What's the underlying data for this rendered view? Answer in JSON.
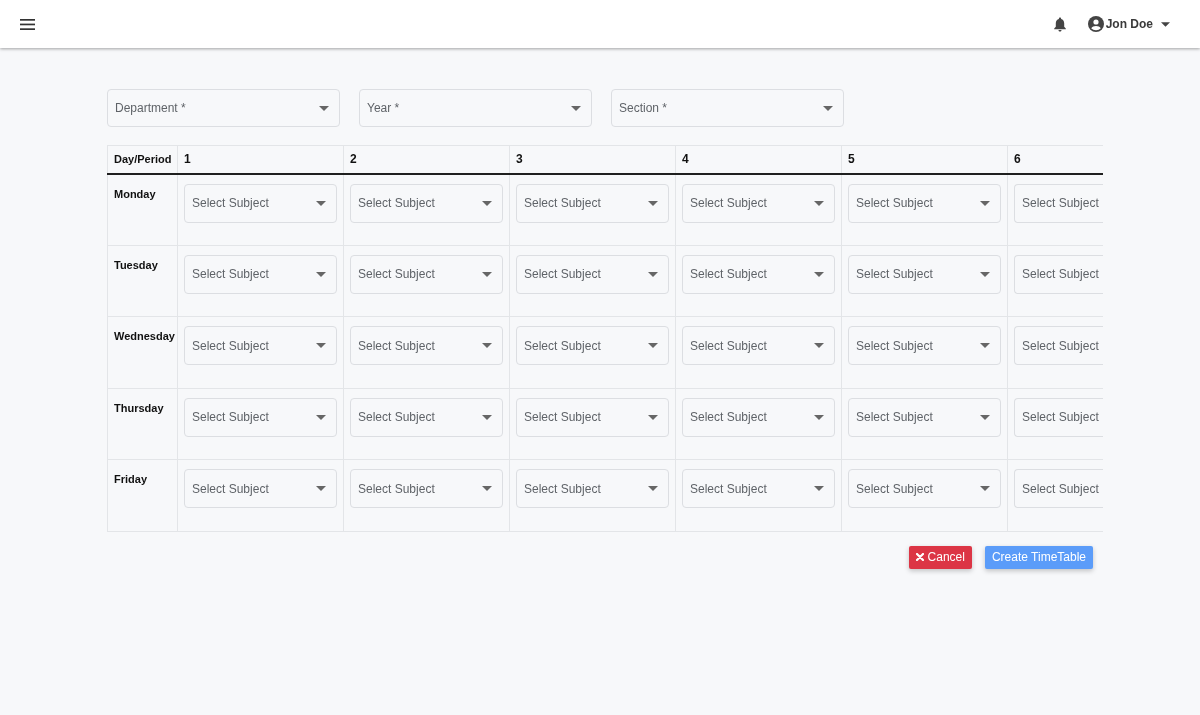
{
  "app_bar": {
    "user_name": "Jon Doe"
  },
  "filters": [
    {
      "placeholder": "Department *"
    },
    {
      "placeholder": "Year *"
    },
    {
      "placeholder": "Section *"
    }
  ],
  "timetable": {
    "corner_heading": "Day/Period",
    "periods": [
      "1",
      "2",
      "3",
      "4",
      "5",
      "6"
    ],
    "rows": [
      {
        "day": "Monday",
        "cells": [
          {
            "placeholder": "Select Subject"
          },
          {
            "placeholder": "Select Subject"
          },
          {
            "placeholder": "Select Subject"
          },
          {
            "placeholder": "Select Subject"
          },
          {
            "placeholder": "Select Subject"
          },
          {
            "placeholder": "Select Subject"
          }
        ]
      },
      {
        "day": "Tuesday",
        "cells": [
          {
            "placeholder": "Select Subject"
          },
          {
            "placeholder": "Select Subject"
          },
          {
            "placeholder": "Select Subject"
          },
          {
            "placeholder": "Select Subject"
          },
          {
            "placeholder": "Select Subject"
          },
          {
            "placeholder": "Select Subject"
          }
        ]
      },
      {
        "day": "Wednesday",
        "cells": [
          {
            "placeholder": "Select Subject"
          },
          {
            "placeholder": "Select Subject"
          },
          {
            "placeholder": "Select Subject"
          },
          {
            "placeholder": "Select Subject"
          },
          {
            "placeholder": "Select Subject"
          },
          {
            "placeholder": "Select Subject"
          }
        ]
      },
      {
        "day": "Thursday",
        "cells": [
          {
            "placeholder": "Select Subject"
          },
          {
            "placeholder": "Select Subject"
          },
          {
            "placeholder": "Select Subject"
          },
          {
            "placeholder": "Select Subject"
          },
          {
            "placeholder": "Select Subject"
          },
          {
            "placeholder": "Select Subject"
          }
        ]
      },
      {
        "day": "Friday",
        "cells": [
          {
            "placeholder": "Select Subject"
          },
          {
            "placeholder": "Select Subject"
          },
          {
            "placeholder": "Select Subject"
          },
          {
            "placeholder": "Select Subject"
          },
          {
            "placeholder": "Select Subject"
          },
          {
            "placeholder": "Select Subject"
          }
        ]
      }
    ]
  },
  "actions": [
    {
      "kind": "cancel",
      "label": "Cancel"
    },
    {
      "kind": "primary",
      "label": "Create TimeTable"
    }
  ]
}
